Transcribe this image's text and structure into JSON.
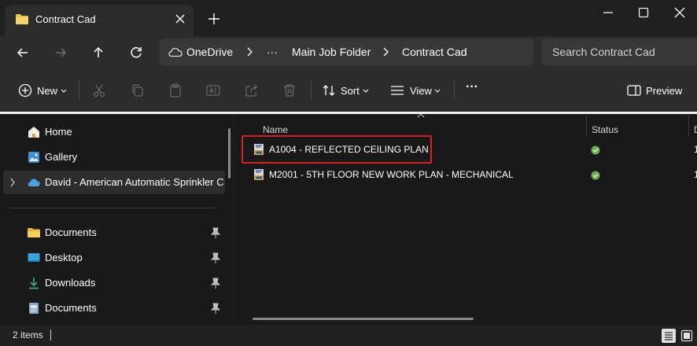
{
  "window": {
    "tab_title": "Contract Cad"
  },
  "address_bar": {
    "segments": [
      "OneDrive",
      "···",
      "Main Job Folder",
      "Contract Cad"
    ],
    "search_placeholder": "Search Contract Cad"
  },
  "command_bar": {
    "new_label": "New",
    "sort_label": "Sort",
    "view_label": "View",
    "more_label": "···",
    "preview_label": "Preview"
  },
  "nav_pane": {
    "items": [
      {
        "label": "Home",
        "icon": "home-icon"
      },
      {
        "label": "Gallery",
        "icon": "gallery-icon"
      },
      {
        "label": "David - American Automatic Sprinkler Co Inc",
        "icon": "onedrive-cloud-icon",
        "selected": true
      },
      {
        "label": "Documents",
        "icon": "folder-icon",
        "pinned": true
      },
      {
        "label": "Desktop",
        "icon": "desktop-icon",
        "pinned": true
      },
      {
        "label": "Downloads",
        "icon": "download-icon",
        "pinned": true
      },
      {
        "label": "Documents",
        "icon": "documents-icon",
        "pinned": true
      }
    ]
  },
  "file_list": {
    "columns": [
      "Name",
      "Status",
      "D"
    ],
    "rows": [
      {
        "name": "A1004 - REFLECTED CEILING PLAN",
        "status": "synced",
        "date": "1",
        "highlighted": true
      },
      {
        "name": "M2001 - 5TH FLOOR NEW WORK PLAN - MECHANICAL",
        "status": "synced",
        "date": "1"
      }
    ]
  },
  "status_bar": {
    "item_count": "2 items"
  },
  "colors": {
    "highlight_border": "#d42020",
    "status_ok": "#6ab04c",
    "folder_yellow": "#f0c24a",
    "onedrive_blue": "#4aa3df"
  }
}
